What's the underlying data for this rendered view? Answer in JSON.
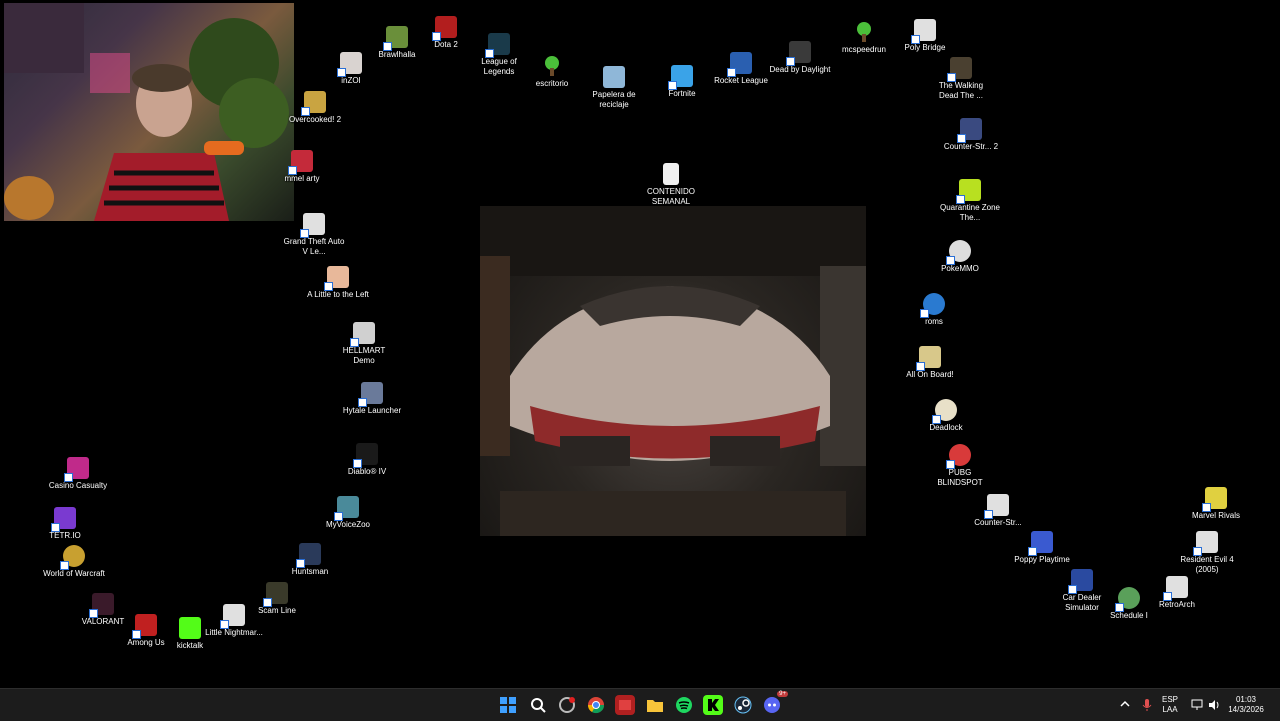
{
  "desktop_icons": {
    "brawlhalla": "Brawlhalla",
    "dota2": "Dota 2",
    "inzoi": "inZOI",
    "league": "League of Legends",
    "escritorio": "escritorio",
    "papelera": "Papelera de reciclaje",
    "fortnite": "Fortnite",
    "rocket": "Rocket League",
    "dbd": "Dead by Daylight",
    "mcspeedrun": "mcspeedrun",
    "poly_bridge": "Poly Bridge",
    "walking_dead": "The Walking Dead The ...",
    "overcooked": "Overcooked! 2",
    "mmel": "mmel arty",
    "cs2": "Counter-Str... 2",
    "quarantine": "Quarantine Zone The...",
    "contenido": "CONTENIDO SEMANAL",
    "gta": "Grand Theft Auto V Le...",
    "pokemmo": "PokeMMO",
    "little_left": "A Little to the Left",
    "roms": "roms",
    "hellmart": "HELLMART Demo",
    "all_on_board": "All On Board!",
    "hytale": "Hytale Launcher",
    "deadlock": "Deadlock",
    "diablo": "Diablo® IV",
    "pubg": "PUBG BLINDSPOT",
    "casino": "Casino Casualty",
    "counter_strike": "Counter-Str...",
    "marvel": "Marvel Rivals",
    "myvoicezoo": "MyVoiceZoo",
    "tetrio": "TETR.IO",
    "poppy": "Poppy Playtime",
    "re4": "Resident Evil 4 (2005)",
    "huntsman": "Huntsman",
    "wow": "World of Warcraft",
    "car_dealer": "Car Dealer Simulator",
    "retroarch": "RetroArch",
    "scam_line": "Scam Line",
    "schedule": "Schedule I",
    "valorant": "VALORANT",
    "among_us": "Among Us",
    "little_nightmares": "Little Nightmar...",
    "kicktalk": "kicktalk"
  },
  "taskbar": {
    "apps": [
      "start-icon",
      "search-icon",
      "recorder-icon",
      "chrome-icon",
      "app-icon",
      "folder-icon",
      "spotify-icon",
      "kick-icon",
      "steam-icon",
      "discord-icon"
    ],
    "discord_badge": "9+",
    "lang_line1": "ESP",
    "lang_line2": "LAA",
    "time": "01:03",
    "date": "14/3/2026"
  },
  "colors": {
    "desktop_bg": "#000000",
    "taskbar_bg": "#1c1c1c",
    "start_blue": "#3fa0ff",
    "kick_green": "#53fc18",
    "spotify_green": "#1ed760",
    "discord_purple": "#5865f2"
  }
}
